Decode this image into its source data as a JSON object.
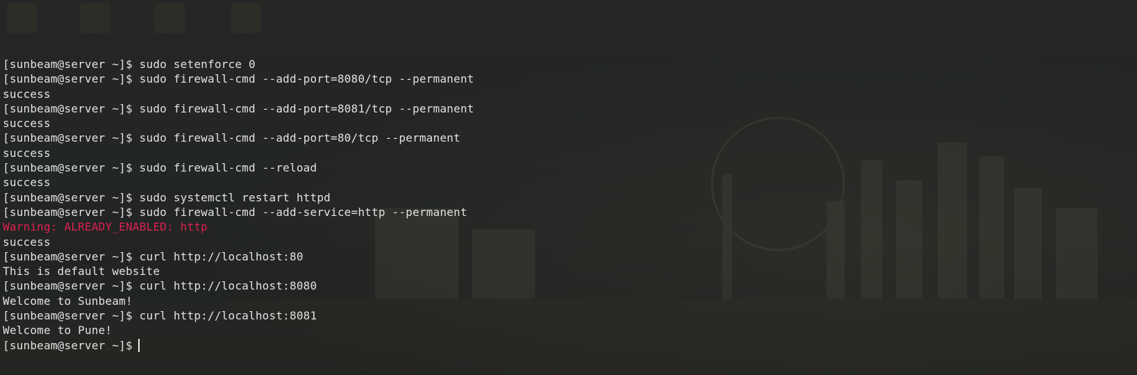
{
  "terminal": {
    "lines": [
      {
        "kind": "command",
        "prompt": "[sunbeam@server ~]$",
        "text": "sudo setenforce 0"
      },
      {
        "kind": "command",
        "prompt": "[sunbeam@server ~]$",
        "text": "sudo firewall-cmd --add-port=8080/tcp --permanent"
      },
      {
        "kind": "output",
        "text": "success"
      },
      {
        "kind": "command",
        "prompt": "[sunbeam@server ~]$",
        "text": "sudo firewall-cmd --add-port=8081/tcp --permanent"
      },
      {
        "kind": "output",
        "text": "success"
      },
      {
        "kind": "command",
        "prompt": "[sunbeam@server ~]$",
        "text": "sudo firewall-cmd --add-port=80/tcp --permanent"
      },
      {
        "kind": "output",
        "text": "success"
      },
      {
        "kind": "command",
        "prompt": "[sunbeam@server ~]$",
        "text": "sudo firewall-cmd --reload"
      },
      {
        "kind": "output",
        "text": "success"
      },
      {
        "kind": "command",
        "prompt": "[sunbeam@server ~]$",
        "text": "sudo systemctl restart httpd"
      },
      {
        "kind": "command",
        "prompt": "[sunbeam@server ~]$",
        "text": "sudo firewall-cmd --add-service=http --permanent"
      },
      {
        "kind": "warning",
        "text": "Warning: ALREADY_ENABLED: http"
      },
      {
        "kind": "output",
        "text": "success"
      },
      {
        "kind": "command",
        "prompt": "[sunbeam@server ~]$",
        "text": "curl http://localhost:80"
      },
      {
        "kind": "output",
        "text": "This is default website"
      },
      {
        "kind": "command",
        "prompt": "[sunbeam@server ~]$",
        "text": "curl http://localhost:8080"
      },
      {
        "kind": "output",
        "text": "Welcome to Sunbeam!"
      },
      {
        "kind": "command",
        "prompt": "[sunbeam@server ~]$",
        "text": "curl http://localhost:8081"
      },
      {
        "kind": "output",
        "text": "Welcome to Pune!"
      }
    ],
    "current_prompt": "[sunbeam@server ~]$",
    "current_input": ""
  },
  "colors": {
    "background": "#232624",
    "text": "#e2e2e2",
    "warning": "#e0204f",
    "cursor": "#f0f0f0"
  }
}
